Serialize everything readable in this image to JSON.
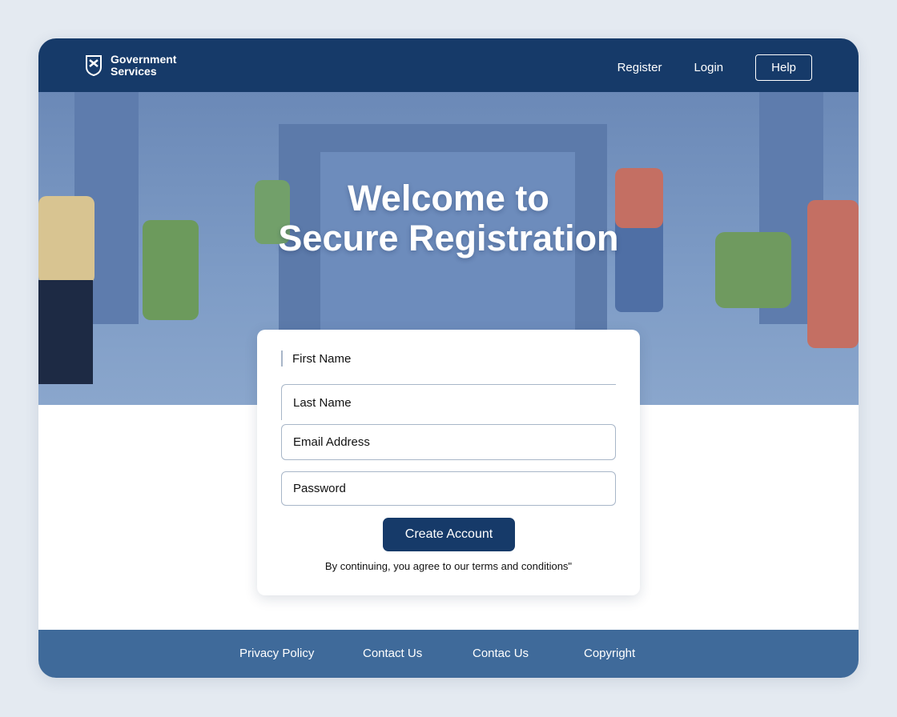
{
  "header": {
    "brand_line1": "Government",
    "brand_line2": "Services",
    "nav": {
      "register": "Register",
      "login": "Login",
      "help": "Help"
    }
  },
  "hero": {
    "title_line1": "Welcome to",
    "title_line2": "Secure Registration"
  },
  "form": {
    "first_name": "First Name",
    "last_name": "Last Name",
    "email": "Email Address",
    "password": "Password",
    "submit": "Create Account",
    "terms": "By continuing, you agree to our terms and conditions\""
  },
  "footer": {
    "links": [
      "Privacy Policy",
      "Contact Us",
      "Contac Us",
      "Copyright"
    ]
  },
  "colors": {
    "primary": "#163a69",
    "footer": "#3f6a9a",
    "hero": "#7392c0"
  }
}
